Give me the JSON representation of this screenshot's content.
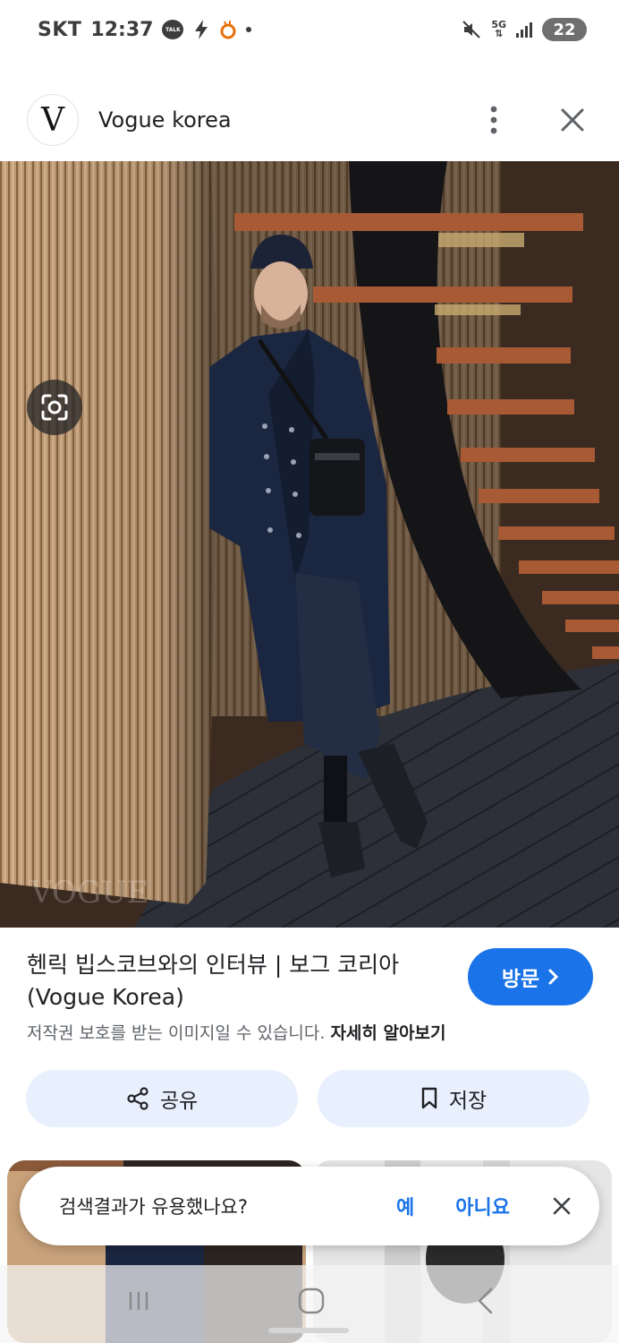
{
  "status_bar": {
    "carrier": "SKT",
    "time": "12:37",
    "talk_badge": "TALK",
    "network": "5G",
    "battery": "22",
    "icons": [
      "kakaotalk-icon",
      "bolt-icon",
      "app-notification-icon",
      "dot-icon",
      "mute-icon",
      "5g-icon",
      "signal-icon",
      "battery-icon"
    ]
  },
  "source": {
    "logo_letter": "V",
    "name": "Vogue korea"
  },
  "image": {
    "icons": [
      "lens-search-icon"
    ],
    "watermark": "VOGUE"
  },
  "caption": {
    "title": "헨릭 빕스코브와의 인터뷰 | 보그 코리아 (Vogue Korea)",
    "copyright_text": "저작권 보호를 받는 이미지일 수 있습니다.",
    "learn_more": "자세히 알아보기"
  },
  "visit_button": {
    "label": "방문"
  },
  "actions": {
    "share_label": "공유",
    "save_label": "저장"
  },
  "feedback": {
    "question": "검색결과가 유용했나요?",
    "yes": "예",
    "no": "아니요"
  },
  "colors": {
    "accent": "#1a73e8",
    "chip_bg": "#e8f0fe",
    "text_primary": "#202124",
    "text_secondary": "#5f6368"
  }
}
